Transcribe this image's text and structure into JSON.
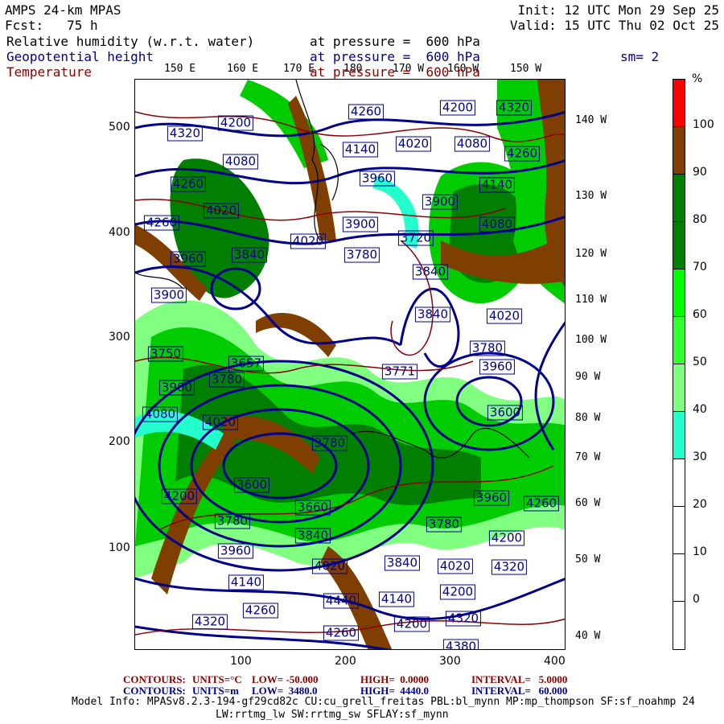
{
  "header": {
    "model": "AMPS 24-km MPAS",
    "forecast": "Fcst:   75 h",
    "init": "Init: 12 UTC Mon 29 Sep 25",
    "valid": "Valid: 15 UTC Thu 02 Oct 25",
    "fields": [
      {
        "name": "Relative humidity (w.r.t. water)",
        "level": "at pressure =  600 hPa",
        "color": "#000000"
      },
      {
        "name": "Geopotential height",
        "level": "at pressure =  600 hPa",
        "color": "#00008b"
      },
      {
        "name": "Temperature",
        "level": "at pressure =  600 hPa",
        "color": "#8b0000"
      }
    ],
    "smoothing": "sm= 2"
  },
  "axes": {
    "top_lon": [
      "150 E",
      "160 E",
      "170 E",
      "180",
      "170 W",
      "160 W",
      "150 W"
    ],
    "right_lon": [
      "140 W",
      "130 W",
      "120 W",
      "110 W",
      "100 W",
      "90 W",
      "80 W",
      "70 W",
      "60 W",
      "50 W",
      "40 W"
    ],
    "left_y": [
      "500",
      "400",
      "300",
      "200",
      "100"
    ],
    "bottom_x": [
      "100",
      "200",
      "300",
      "400"
    ]
  },
  "colorbar": {
    "unit": "%",
    "labels": [
      "100",
      "90",
      "80",
      "70",
      "60",
      "50",
      "40",
      "30",
      "20",
      "10",
      "0"
    ],
    "colors": [
      "#ff0000",
      "#7f3f00",
      "#007f00",
      "#007f00",
      "#00ff00",
      "#33ff33",
      "#80ff80",
      "#22ffcc",
      "#ffffff",
      "#ffffff",
      "#ffffff",
      "#ffffff"
    ]
  },
  "contour_labels": [
    "4260",
    "4200",
    "4320",
    "4200",
    "4320",
    "4140",
    "4020",
    "4080",
    "4260",
    "4080",
    "4260",
    "3960",
    "4140",
    "3900",
    "4020",
    "4260",
    "4080",
    "3900",
    "3720",
    "4020",
    "3780",
    "3960",
    "3840",
    "3840",
    "3900",
    "3840",
    "4020",
    "3780",
    "3750",
    "3657",
    "3771",
    "3960",
    "3900",
    "3780",
    "4080",
    "4020",
    "3600",
    "3780",
    "4200",
    "3600",
    "3660",
    "3780",
    "3840",
    "3960",
    "4260",
    "3780",
    "4200",
    "3960",
    "4020",
    "3840",
    "4020",
    "4320",
    "4140",
    "4440",
    "4140",
    "4200",
    "4260",
    "4320",
    "4200",
    "4320",
    "4260",
    "4380"
  ],
  "footer": {
    "temp_contours": {
      "label": "CONTOURS:",
      "units": "UNITS=°C",
      "low": "LOW= -50.000",
      "high": "HIGH=  0.0000",
      "interval": "INTERVAL=   5.0000"
    },
    "height_contours": {
      "label": "CONTOURS:",
      "units": "UNITS=m",
      "low": "LOW=  3480.0",
      "high": "HIGH=  4440.0",
      "interval": "INTERVAL=   60.000"
    },
    "model_info_1": "Model Info: MPASv8.2.3-194-gf29cd82c CU:cu_grell_freitas PBL:bl_mynn MP:mp_thompson SF:sf_noahmp 24",
    "model_info_2": "LW:rrtmg_lw SW:rrtmg_sw SFLAY:sf_mynn"
  }
}
